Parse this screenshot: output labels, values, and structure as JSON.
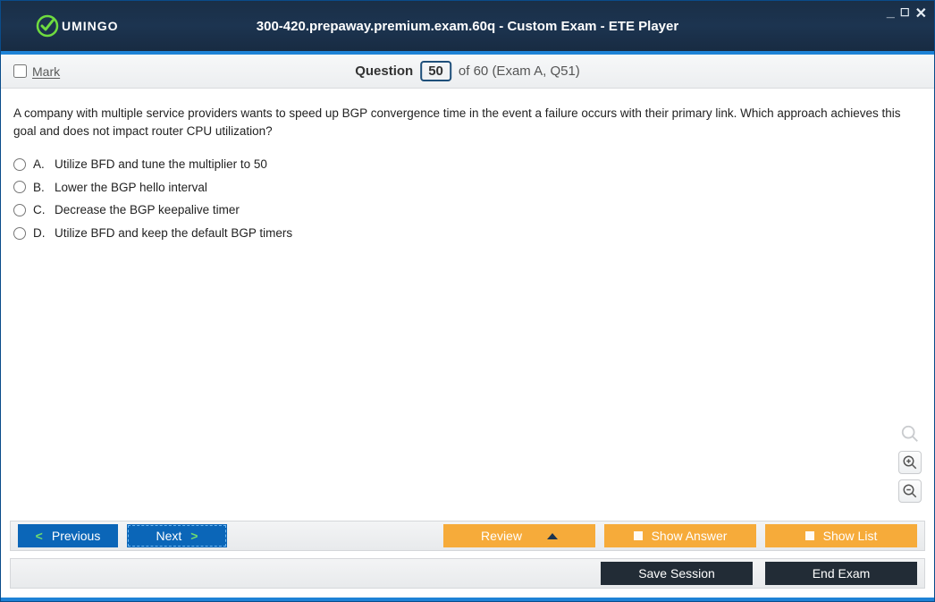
{
  "window": {
    "title": "300-420.prepaway.premium.exam.60q - Custom Exam - ETE Player",
    "logo_text": "UMINGO"
  },
  "header": {
    "mark_label": "Mark",
    "question_word": "Question",
    "current_number": "50",
    "of_text": "of 60",
    "exam_ref": "(Exam A, Q51)"
  },
  "question": {
    "text": "A company with multiple service providers wants to speed up BGP convergence time in the event a failure occurs with their primary link. Which approach achieves this goal and does not impact router CPU utilization?",
    "options": [
      {
        "letter": "A.",
        "text": "Utilize BFD and tune the multiplier to 50"
      },
      {
        "letter": "B.",
        "text": "Lower the BGP hello interval"
      },
      {
        "letter": "C.",
        "text": "Decrease the BGP keepalive timer"
      },
      {
        "letter": "D.",
        "text": "Utilize BFD and keep the default BGP timers"
      }
    ]
  },
  "toolbar": {
    "previous": "Previous",
    "next": "Next",
    "review": "Review",
    "show_answer": "Show Answer",
    "show_list": "Show List",
    "save_session": "Save Session",
    "end_exam": "End Exam"
  }
}
